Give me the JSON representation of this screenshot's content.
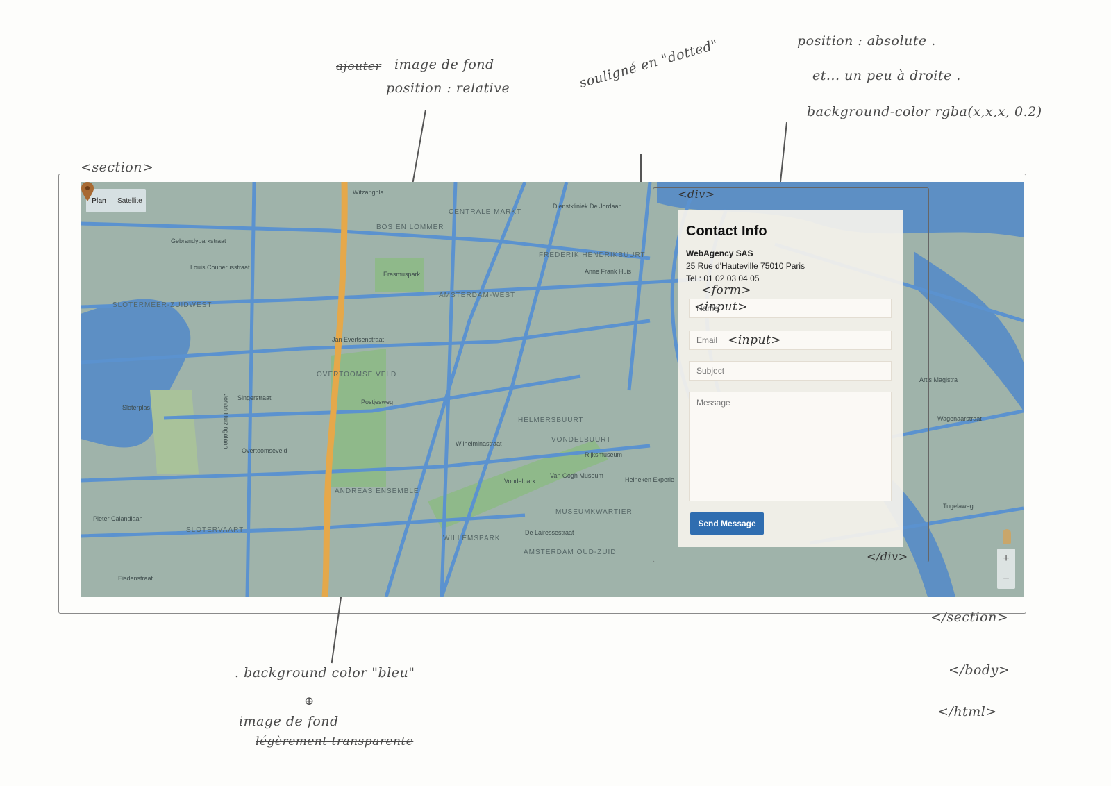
{
  "annotations": {
    "bg_image_top": "image de fond",
    "struck_word": "ajouter",
    "position_relative": "position : relative",
    "dotted": "souligné en \"dotted\"",
    "position_absolute": "position : absolute .",
    "shift_right": "et... un peu à droite .",
    "bg_rgba": "background-color rgba(x,x,x, 0.2)",
    "section_open": "<section>",
    "section_close": "</section>",
    "div_open": "<div>",
    "div_close": "</div>",
    "form_tag": "<form>",
    "input_tag_1": "<input>",
    "input_tag_2": "<input>",
    "bg_color_blue": ". background color \"bleu\"",
    "plus_sign": "⊕",
    "bg_image_bottom": "image de fond",
    "struck_bottom": "légèrement transparente",
    "body_close": "</body>",
    "html_close": "</html>"
  },
  "map": {
    "type_buttons": [
      "Plan",
      "Satellite"
    ],
    "active_type": "Plan",
    "labels": [
      "Witzanghla",
      "CENTRALE MARKT",
      "Dienstkliniek De Jordaan",
      "BOS EN LOMMER",
      "FREDERIK HENDRIKBUURT",
      "AMSTERDAM-WEST",
      "Anne Frank Huis",
      "Erasmuspark",
      "Gebrandyparkstraat",
      "Louis Couperusstraat",
      "SLOTERMEER-ZUIDWEST",
      "Jan Evertsenstraat",
      "OVERTOOMSE VELD",
      "Postjesweg",
      "Singerstraat",
      "Sloterplas",
      "Overtoomseveld",
      "Johan Huizingalaan",
      "Wilhelminastraat",
      "HELMERSBUURT",
      "VONDELBUURT",
      "Vondelpark",
      "Van Gogh Museum",
      "Rijksmuseum",
      "ANDREAS ENSEMBLE",
      "SLOTERVAART",
      "Pieter Calandlaan",
      "WILLEMSPARK",
      "MUSEUMKWARTIER",
      "AMSTERDAM OUD-ZUID",
      "De Lairessestraat",
      "Heineken Experie",
      "Eisdenstraat",
      "Wagenaarstraat",
      "Artis Magistra",
      "Tugelaweg"
    ],
    "zoom_in": "+",
    "zoom_out": "−"
  },
  "contact": {
    "title": "Contact Info",
    "company": "WebAgency SAS",
    "address": "25 Rue d'Hauteville 75010 Paris",
    "tel": "Tel : 01 02 03 04 05",
    "name_placeholder": "Name",
    "email_placeholder": "Email",
    "subject_placeholder": "Subject",
    "message_placeholder": "Message",
    "send_label": "Send Message"
  },
  "colors": {
    "map_water": "#5d8fc4",
    "map_land": "#9fb3aa",
    "map_green": "#8fb98a",
    "map_road": "#5b92cf",
    "map_highway": "#e5a84a",
    "button": "#2f6db0"
  }
}
